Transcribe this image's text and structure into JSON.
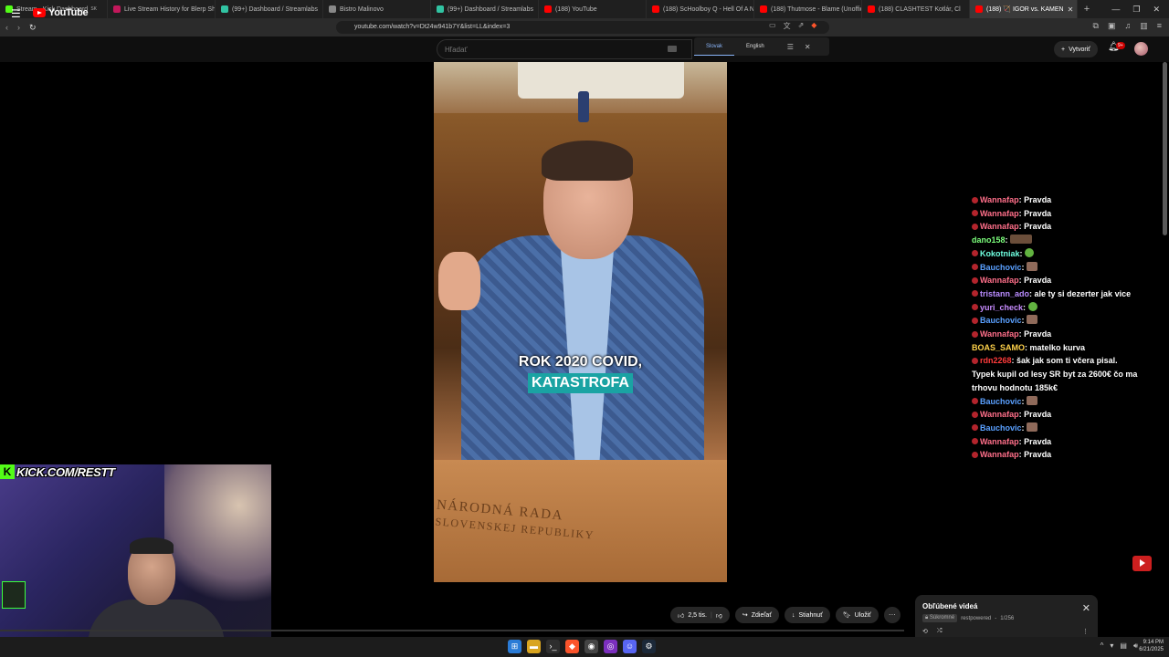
{
  "browser": {
    "tabs": [
      {
        "label": "Stream - Kick Dashboard",
        "color": "#53fc18"
      },
      {
        "label": "Live Stream History for Blerp Share",
        "color": "#c2185b"
      },
      {
        "label": "(99+) Dashboard / Streamlabs",
        "color": "#31c3a2"
      },
      {
        "label": "Bistro Malinovo",
        "color": "#888888"
      },
      {
        "label": "(99+) Dashboard / Streamlabs",
        "color": "#31c3a2"
      },
      {
        "label": "(188) YouTube",
        "color": "#ff0000"
      },
      {
        "label": "(188) ScHoolboy Q - Hell Of A Nig",
        "color": "#ff0000"
      },
      {
        "label": "(188) Thutmose - Blame (Unofficia",
        "color": "#ff0000"
      },
      {
        "label": "(188) CLASHTEST Kotlár, Cl",
        "color": "#ff0000"
      },
      {
        "label": "(188) 🏹 IGOR vs. KAMEN",
        "color": "#ff0000"
      }
    ],
    "new_tab": "+",
    "url": "youtube.com/watch?v=Dt24w941b7Y&list=LL&index=3"
  },
  "youtube": {
    "logo": "YouTube",
    "region": "SK",
    "search_placeholder": "Hľadať",
    "create_label": "Vytvoriť",
    "notifications": "9+"
  },
  "translate": {
    "lang1": "Slovak",
    "lang2": "English"
  },
  "video": {
    "caption_line1": "ROK 2020 COVID,",
    "caption_line2": "KATASTROFA",
    "lectern_line1": "NÁRODNÁ RADA",
    "lectern_line2": "SLOVENSKEJ REPUBLIKY"
  },
  "chat": [
    {
      "user": "Wannafap",
      "color": "#ff6f8a",
      "msg": "Pravda"
    },
    {
      "user": "Wannafap",
      "color": "#ff6f8a",
      "msg": "Pravda"
    },
    {
      "user": "Wannafap",
      "color": "#ff6f8a",
      "msg": "Pravda"
    },
    {
      "user": "dano158",
      "color": "#7cff7c",
      "msg": ""
    },
    {
      "user": "Kokotniak",
      "color": "#6fffe0",
      "msg": ""
    },
    {
      "user": "Bauchovic",
      "color": "#5aa0ff",
      "msg": ""
    },
    {
      "user": "Wannafap",
      "color": "#ff6f8a",
      "msg": "Pravda"
    },
    {
      "user": "tristann_ado",
      "color": "#b98cff",
      "msg": "ale ty si dezerter jak vice"
    },
    {
      "user": "yuri_check",
      "color": "#c88cff",
      "msg": ""
    },
    {
      "user": "Bauchovic",
      "color": "#5aa0ff",
      "msg": ""
    },
    {
      "user": "Wannafap",
      "color": "#ff6f8a",
      "msg": "Pravda"
    },
    {
      "user": "BOAS_SAMO",
      "color": "#ffd24a",
      "msg": "matelko kurva"
    },
    {
      "user": "rdn2268",
      "color": "#ff3b3b",
      "msg": "šak jak som ti včera pisal."
    },
    {
      "user": "",
      "color": "#ffffff",
      "msg": "Typek kupil od lesy SR byt za 2600€ čo ma"
    },
    {
      "user": "",
      "color": "#ffffff",
      "msg": "trhovu hodnotu 185k€"
    },
    {
      "user": "Bauchovic",
      "color": "#5aa0ff",
      "msg": ""
    },
    {
      "user": "Wannafap",
      "color": "#ff6f8a",
      "msg": "Pravda"
    },
    {
      "user": "Bauchovic",
      "color": "#5aa0ff",
      "msg": ""
    },
    {
      "user": "Wannafap",
      "color": "#ff6f8a",
      "msg": "Pravda"
    },
    {
      "user": "Wannafap",
      "color": "#ff6f8a",
      "msg": "Pravda"
    }
  ],
  "webcam": {
    "kick_label": "KICK.COM/RESTT"
  },
  "actions": {
    "likes": "2,5 tis.",
    "share": "Zdieľať",
    "download": "Stiahnuť",
    "save": "Uložiť",
    "more": "···"
  },
  "playlist": {
    "title": "Obľúbené videá",
    "privacy": "Súkromné",
    "owner": "restpowered",
    "position": "1/256"
  },
  "taskbar": {
    "time": "9:14 PM",
    "date": "6/21/2025"
  }
}
